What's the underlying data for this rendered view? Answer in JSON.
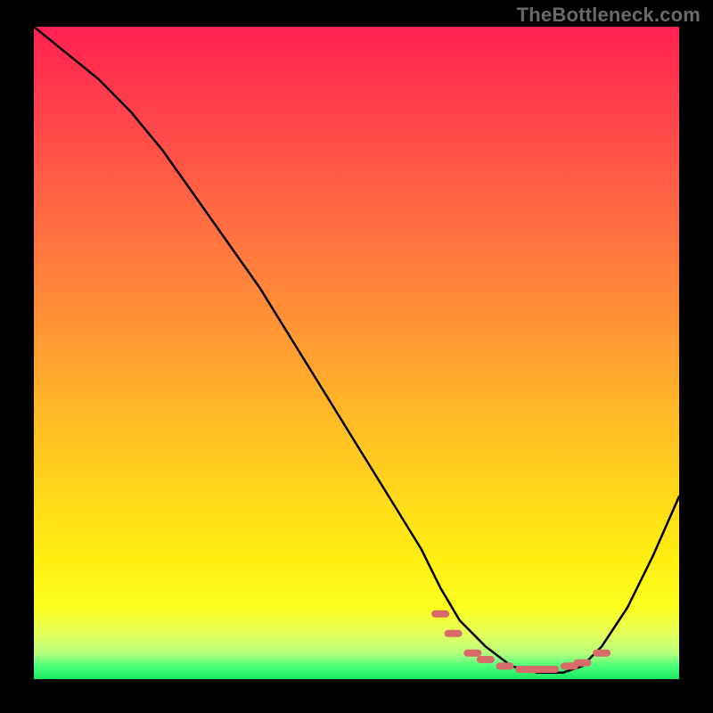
{
  "watermark": "TheBottleneck.com",
  "chart_data": {
    "type": "line",
    "title": "",
    "xlabel": "",
    "ylabel": "",
    "xlim": [
      0,
      100
    ],
    "ylim": [
      0,
      100
    ],
    "grid": false,
    "legend": false,
    "series": [
      {
        "name": "bottleneck-curve",
        "x": [
          0,
          5,
          10,
          15,
          20,
          25,
          30,
          35,
          40,
          45,
          50,
          55,
          60,
          63,
          66,
          70,
          74,
          78,
          82,
          85,
          88,
          92,
          96,
          100
        ],
        "y": [
          100,
          96,
          92,
          87,
          81,
          74,
          67,
          60,
          52,
          44,
          36,
          28,
          20,
          14,
          9,
          5,
          2,
          1,
          1,
          2,
          5,
          11,
          19,
          28
        ]
      }
    ],
    "markers": {
      "name": "optimal-range-dots",
      "color": "#d86a6a",
      "x": [
        63,
        65,
        68,
        70,
        73,
        76,
        78,
        80,
        83,
        85,
        88
      ],
      "y": [
        10,
        7,
        4,
        3,
        2,
        1.5,
        1.5,
        1.5,
        2,
        2.5,
        4
      ]
    },
    "colors": {
      "gradient_top": "#ff2152",
      "gradient_mid": "#ffd91a",
      "gradient_bottom": "#18e862",
      "curve": "#000000",
      "markers": "#d86a6a",
      "frame": "#000000"
    }
  }
}
